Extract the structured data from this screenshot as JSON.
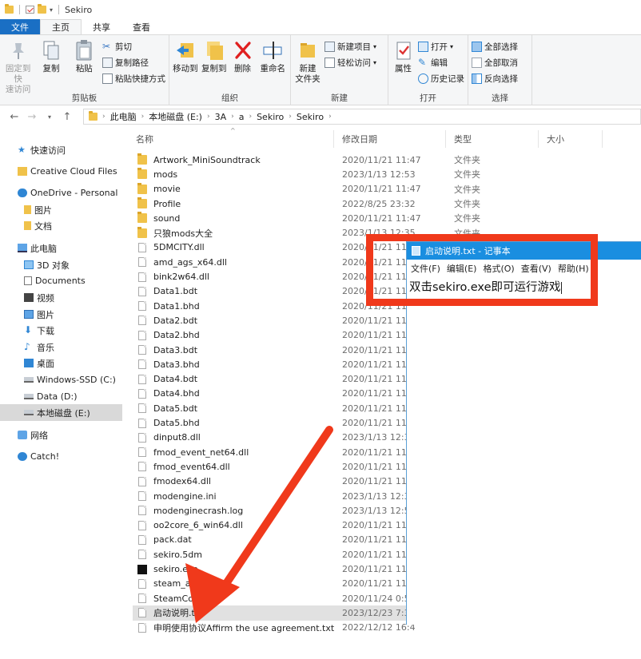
{
  "window": {
    "title": "Sekiro"
  },
  "tabs": [
    "文件",
    "主页",
    "共享",
    "查看"
  ],
  "ribbon": {
    "clipboard": {
      "label": "剪贴板",
      "pin": "固定到快\n速访问",
      "copy": "复制",
      "paste": "粘贴",
      "cut": "剪切",
      "copy_path": "复制路径",
      "paste_shortcut": "粘贴快捷方式"
    },
    "organize": {
      "label": "组织",
      "move_to": "移动到",
      "copy_to": "复制到",
      "delete": "删除",
      "rename": "重命名"
    },
    "new": {
      "label": "新建",
      "new_folder": "新建\n文件夹",
      "new_item": "新建项目",
      "easy_access": "轻松访问"
    },
    "open": {
      "label": "打开",
      "properties": "属性",
      "open": "打开",
      "edit": "编辑",
      "history": "历史记录"
    },
    "select": {
      "label": "选择",
      "select_all": "全部选择",
      "select_none": "全部取消",
      "invert": "反向选择"
    }
  },
  "address": {
    "crumbs": [
      "此电脑",
      "本地磁盘 (E:)",
      "3A",
      "a",
      "Sekiro",
      "Sekiro"
    ]
  },
  "nav": [
    {
      "label": "快速访问",
      "icon": "star-icon"
    },
    {
      "label": "Creative Cloud Files",
      "icon": "folder-icon"
    },
    {
      "label": "OneDrive - Personal",
      "icon": "cloud-icon"
    },
    {
      "label": "图片",
      "icon": "folder-icon"
    },
    {
      "label": "文档",
      "icon": "folder-icon"
    },
    {
      "label": "此电脑",
      "icon": "pc-icon"
    },
    {
      "label": "3D 对象",
      "icon": "cube-icon"
    },
    {
      "label": "Documents",
      "icon": "document-icon"
    },
    {
      "label": "视频",
      "icon": "video-icon"
    },
    {
      "label": "图片",
      "icon": "image-icon"
    },
    {
      "label": "下载",
      "icon": "download-icon"
    },
    {
      "label": "音乐",
      "icon": "music-icon"
    },
    {
      "label": "桌面",
      "icon": "desktop-icon"
    },
    {
      "label": "Windows-SSD (C:)",
      "icon": "drive-icon"
    },
    {
      "label": "Data (D:)",
      "icon": "drive-icon"
    },
    {
      "label": "本地磁盘 (E:)",
      "icon": "drive-icon"
    },
    {
      "label": "网络",
      "icon": "network-icon"
    },
    {
      "label": "Catch!",
      "icon": "catch-icon"
    }
  ],
  "columns": {
    "name": "名称",
    "date": "修改日期",
    "type": "类型",
    "size": "大小"
  },
  "files": [
    {
      "name": "Artwork_MiniSoundtrack",
      "date": "2020/11/21 11:47",
      "type": "文件夹",
      "kind": "folder"
    },
    {
      "name": "mods",
      "date": "2023/1/13 12:53",
      "type": "文件夹",
      "kind": "folder"
    },
    {
      "name": "movie",
      "date": "2020/11/21 11:47",
      "type": "文件夹",
      "kind": "folder"
    },
    {
      "name": "Profile",
      "date": "2022/8/25 23:32",
      "type": "文件夹",
      "kind": "folder"
    },
    {
      "name": "sound",
      "date": "2020/11/21 11:47",
      "type": "文件夹",
      "kind": "folder"
    },
    {
      "name": "只狼mods大全",
      "date": "2023/1/13 12:35",
      "type": "文件夹",
      "kind": "folder"
    },
    {
      "name": "5DMCITY.dll",
      "date": "2020/11/21 11:4",
      "type": "",
      "kind": "file"
    },
    {
      "name": "amd_ags_x64.dll",
      "date": "2020/11/21 11:4",
      "type": "",
      "kind": "file"
    },
    {
      "name": "bink2w64.dll",
      "date": "2020/11/21 11:4",
      "type": "",
      "kind": "file"
    },
    {
      "name": "Data1.bdt",
      "date": "2020/11/21 11:4",
      "type": "",
      "kind": "file"
    },
    {
      "name": "Data1.bhd",
      "date": "2020/11/21 11:4",
      "type": "",
      "kind": "file"
    },
    {
      "name": "Data2.bdt",
      "date": "2020/11/21 11:4",
      "type": "",
      "kind": "file"
    },
    {
      "name": "Data2.bhd",
      "date": "2020/11/21 11:4",
      "type": "",
      "kind": "file"
    },
    {
      "name": "Data3.bdt",
      "date": "2020/11/21 11:4",
      "type": "",
      "kind": "file"
    },
    {
      "name": "Data3.bhd",
      "date": "2020/11/21 11:4",
      "type": "",
      "kind": "file"
    },
    {
      "name": "Data4.bdt",
      "date": "2020/11/21 11:4",
      "type": "",
      "kind": "file"
    },
    {
      "name": "Data4.bhd",
      "date": "2020/11/21 11:4",
      "type": "",
      "kind": "file"
    },
    {
      "name": "Data5.bdt",
      "date": "2020/11/21 11:4",
      "type": "",
      "kind": "file"
    },
    {
      "name": "Data5.bhd",
      "date": "2020/11/21 11:4",
      "type": "",
      "kind": "file"
    },
    {
      "name": "dinput8.dll",
      "date": "2023/1/13 12:35",
      "type": "",
      "kind": "file"
    },
    {
      "name": "fmod_event_net64.dll",
      "date": "2020/11/21 11:4",
      "type": "",
      "kind": "file"
    },
    {
      "name": "fmod_event64.dll",
      "date": "2020/11/21 11:4",
      "type": "",
      "kind": "file"
    },
    {
      "name": "fmodex64.dll",
      "date": "2020/11/21 11:4",
      "type": "",
      "kind": "file"
    },
    {
      "name": "modengine.ini",
      "date": "2023/1/13 12:35",
      "type": "",
      "kind": "file"
    },
    {
      "name": "modenginecrash.log",
      "date": "2023/1/13 12:56",
      "type": "",
      "kind": "file"
    },
    {
      "name": "oo2core_6_win64.dll",
      "date": "2020/11/21 11:4",
      "type": "",
      "kind": "file"
    },
    {
      "name": "pack.dat",
      "date": "2020/11/21 11:4",
      "type": "",
      "kind": "file"
    },
    {
      "name": "sekiro.5dm",
      "date": "2020/11/21 11:4",
      "type": "",
      "kind": "file"
    },
    {
      "name": "sekiro.exe",
      "date": "2020/11/21 11:4",
      "type": "",
      "kind": "exe"
    },
    {
      "name": "steam_api64.d",
      "date": "2020/11/21 11:4",
      "type": "",
      "kind": "file"
    },
    {
      "name": "SteamConfig.i",
      "date": "2020/11/24 0:58",
      "type": "",
      "kind": "file"
    },
    {
      "name": "启动说明.txt",
      "date": "2023/12/23 7:34",
      "type": "",
      "kind": "file",
      "selected": true
    },
    {
      "name": "申明使用协议Affirm the use agreement.txt",
      "date": "2022/12/12 16:4",
      "type": "",
      "kind": "file"
    }
  ],
  "notepad": {
    "title": "启动说明.txt - 记事本",
    "menu": [
      "文件(F)",
      "编辑(E)",
      "格式(O)",
      "查看(V)",
      "帮助(H)"
    ],
    "text": "双击sekiro.exe即可运行游戏"
  },
  "colors": {
    "accent": "#1a6fc4",
    "annotation": "#f0391b",
    "notepad_title": "#1a8ee0"
  }
}
